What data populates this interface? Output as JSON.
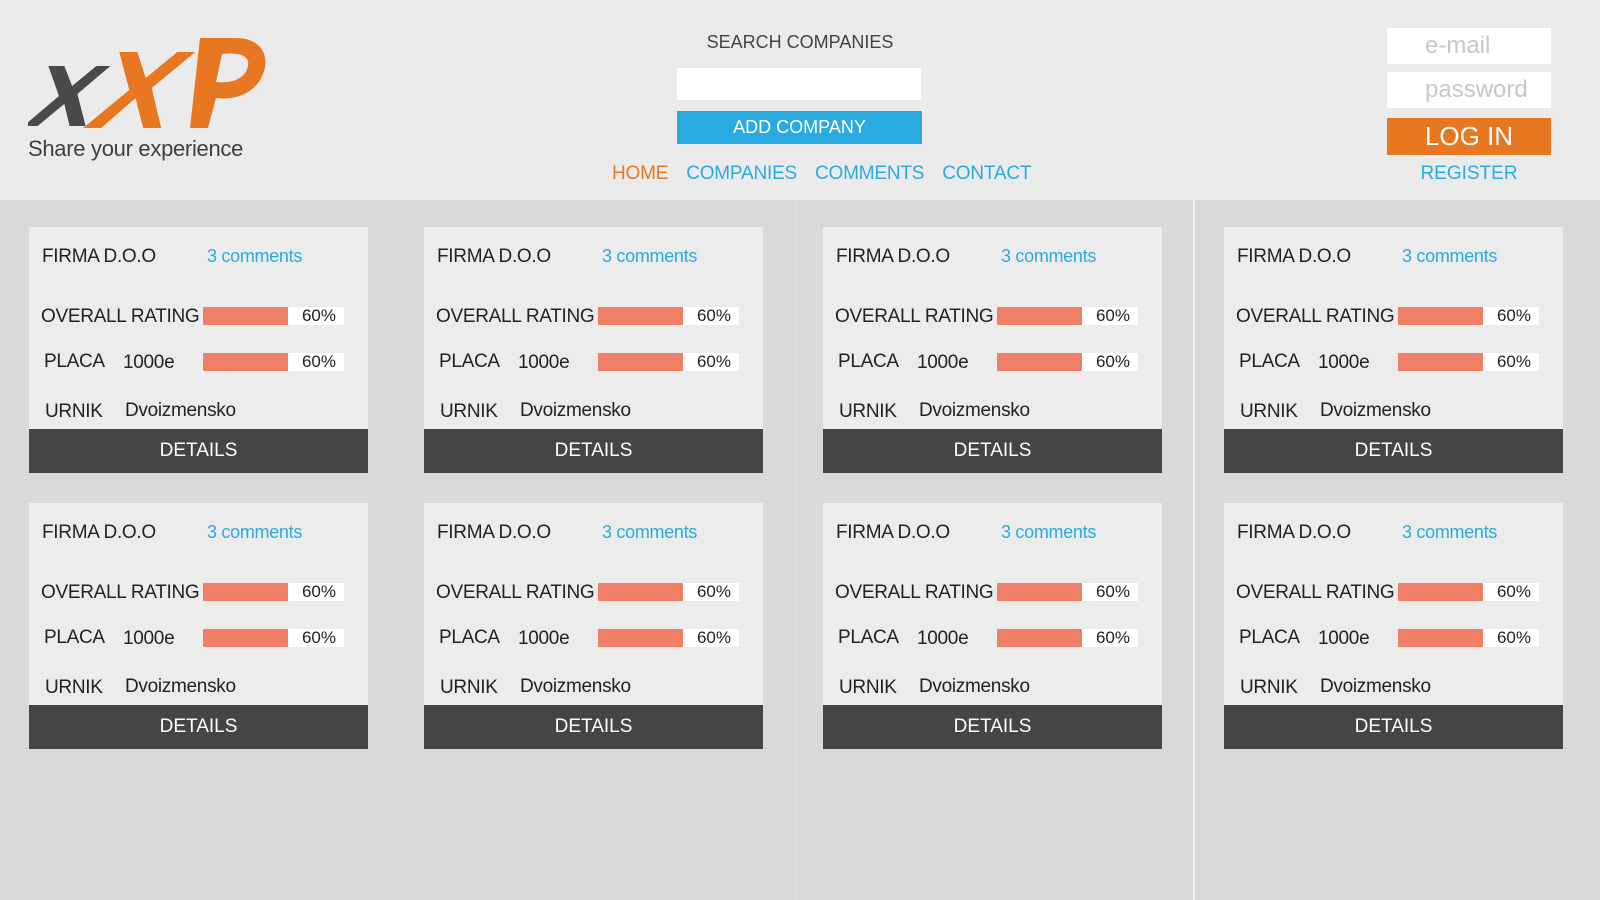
{
  "brand": {
    "logo_text": "xXP",
    "tagline": "Share your experience",
    "colors": {
      "orange": "#e87722",
      "dark": "#4a4a4a",
      "blue": "#29aae1"
    }
  },
  "search": {
    "label": "SEARCH COMPANIES",
    "value": "",
    "add_button": "ADD COMPANY"
  },
  "nav": [
    {
      "label": "HOME",
      "active": true
    },
    {
      "label": "COMPANIES",
      "active": false
    },
    {
      "label": "COMMENTS",
      "active": false
    },
    {
      "label": "CONTACT",
      "active": false
    }
  ],
  "auth": {
    "email_placeholder": "e-mail",
    "password_placeholder": "password",
    "login_button": "LOG IN",
    "register_link": "REGISTER"
  },
  "labels": {
    "overall_rating": "OVERALL RATING",
    "placa": "PLACA",
    "urnik": "URNIK",
    "details": "DETAILS"
  },
  "companies": [
    {
      "name": "FIRMA D.O.O",
      "comments": "3 comments",
      "overall_rating_pct": "60%",
      "overall_rating": 0.6,
      "placa_value": "1000e",
      "placa_pct": "60%",
      "placa_rating": 0.6,
      "urnik_value": "Dvoizmensko"
    },
    {
      "name": "FIRMA D.O.O",
      "comments": "3 comments",
      "overall_rating_pct": "60%",
      "overall_rating": 0.6,
      "placa_value": "1000e",
      "placa_pct": "60%",
      "placa_rating": 0.6,
      "urnik_value": "Dvoizmensko"
    },
    {
      "name": "FIRMA D.O.O",
      "comments": "3 comments",
      "overall_rating_pct": "60%",
      "overall_rating": 0.6,
      "placa_value": "1000e",
      "placa_pct": "60%",
      "placa_rating": 0.6,
      "urnik_value": "Dvoizmensko"
    },
    {
      "name": "FIRMA D.O.O",
      "comments": "3 comments",
      "overall_rating_pct": "60%",
      "overall_rating": 0.6,
      "placa_value": "1000e",
      "placa_pct": "60%",
      "placa_rating": 0.6,
      "urnik_value": "Dvoizmensko"
    },
    {
      "name": "FIRMA D.O.O",
      "comments": "3 comments",
      "overall_rating_pct": "60%",
      "overall_rating": 0.6,
      "placa_value": "1000e",
      "placa_pct": "60%",
      "placa_rating": 0.6,
      "urnik_value": "Dvoizmensko"
    },
    {
      "name": "FIRMA D.O.O",
      "comments": "3 comments",
      "overall_rating_pct": "60%",
      "overall_rating": 0.6,
      "placa_value": "1000e",
      "placa_pct": "60%",
      "placa_rating": 0.6,
      "urnik_value": "Dvoizmensko"
    },
    {
      "name": "FIRMA D.O.O",
      "comments": "3 comments",
      "overall_rating_pct": "60%",
      "overall_rating": 0.6,
      "placa_value": "1000e",
      "placa_pct": "60%",
      "placa_rating": 0.6,
      "urnik_value": "Dvoizmensko"
    },
    {
      "name": "FIRMA D.O.O",
      "comments": "3 comments",
      "overall_rating_pct": "60%",
      "overall_rating": 0.6,
      "placa_value": "1000e",
      "placa_pct": "60%",
      "placa_rating": 0.6,
      "urnik_value": "Dvoizmensko"
    }
  ]
}
